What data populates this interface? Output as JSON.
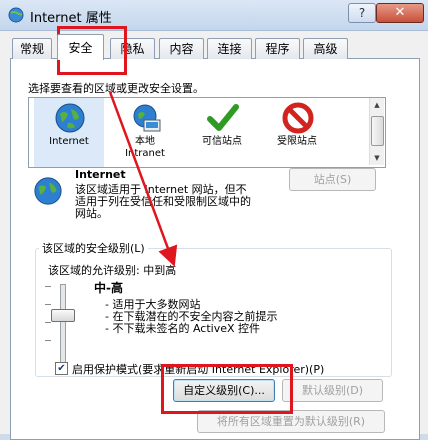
{
  "window": {
    "title": "Internet 属性",
    "help": "?",
    "close": "✕"
  },
  "tabs": [
    "常规",
    "安全",
    "隐私",
    "内容",
    "连接",
    "程序",
    "高级"
  ],
  "active_tab": "安全",
  "zones_prompt": "选择要查看的区域或更改安全设置。",
  "zones": [
    {
      "icon": "globe-icon",
      "label": "Internet"
    },
    {
      "icon": "intranet-icon",
      "label": "本地\nIntranet"
    },
    {
      "icon": "check-icon",
      "label": "可信站点"
    },
    {
      "icon": "restricted-icon",
      "label": "受限站点"
    }
  ],
  "selected_zone": {
    "title": "Internet",
    "description": "该区域适用于 Internet 网站，但不适用于列在受信任和受限制区域中的网站。",
    "sites_button": "站点(S)"
  },
  "security_level": {
    "group_title": "该区域的安全级别(L)",
    "allowed_label": "该区域的允许级别: 中到高",
    "level": "中-高",
    "bullets": [
      "- 适用于大多数网站",
      "- 在下载潜在的不安全内容之前提示",
      "- 不下载未签名的 ActiveX 控件"
    ],
    "protected_mode": "启用保护模式(要求重新启动 Internet Explorer)(P)",
    "protected_mode_checked": true
  },
  "buttons": {
    "custom": "自定义级别(C)...",
    "default": "默认级别(D)",
    "reset_all": "将所有区域重置为默认级别(R)"
  },
  "colors": {
    "highlight": "#e0161f",
    "selection": "#3399ff"
  }
}
